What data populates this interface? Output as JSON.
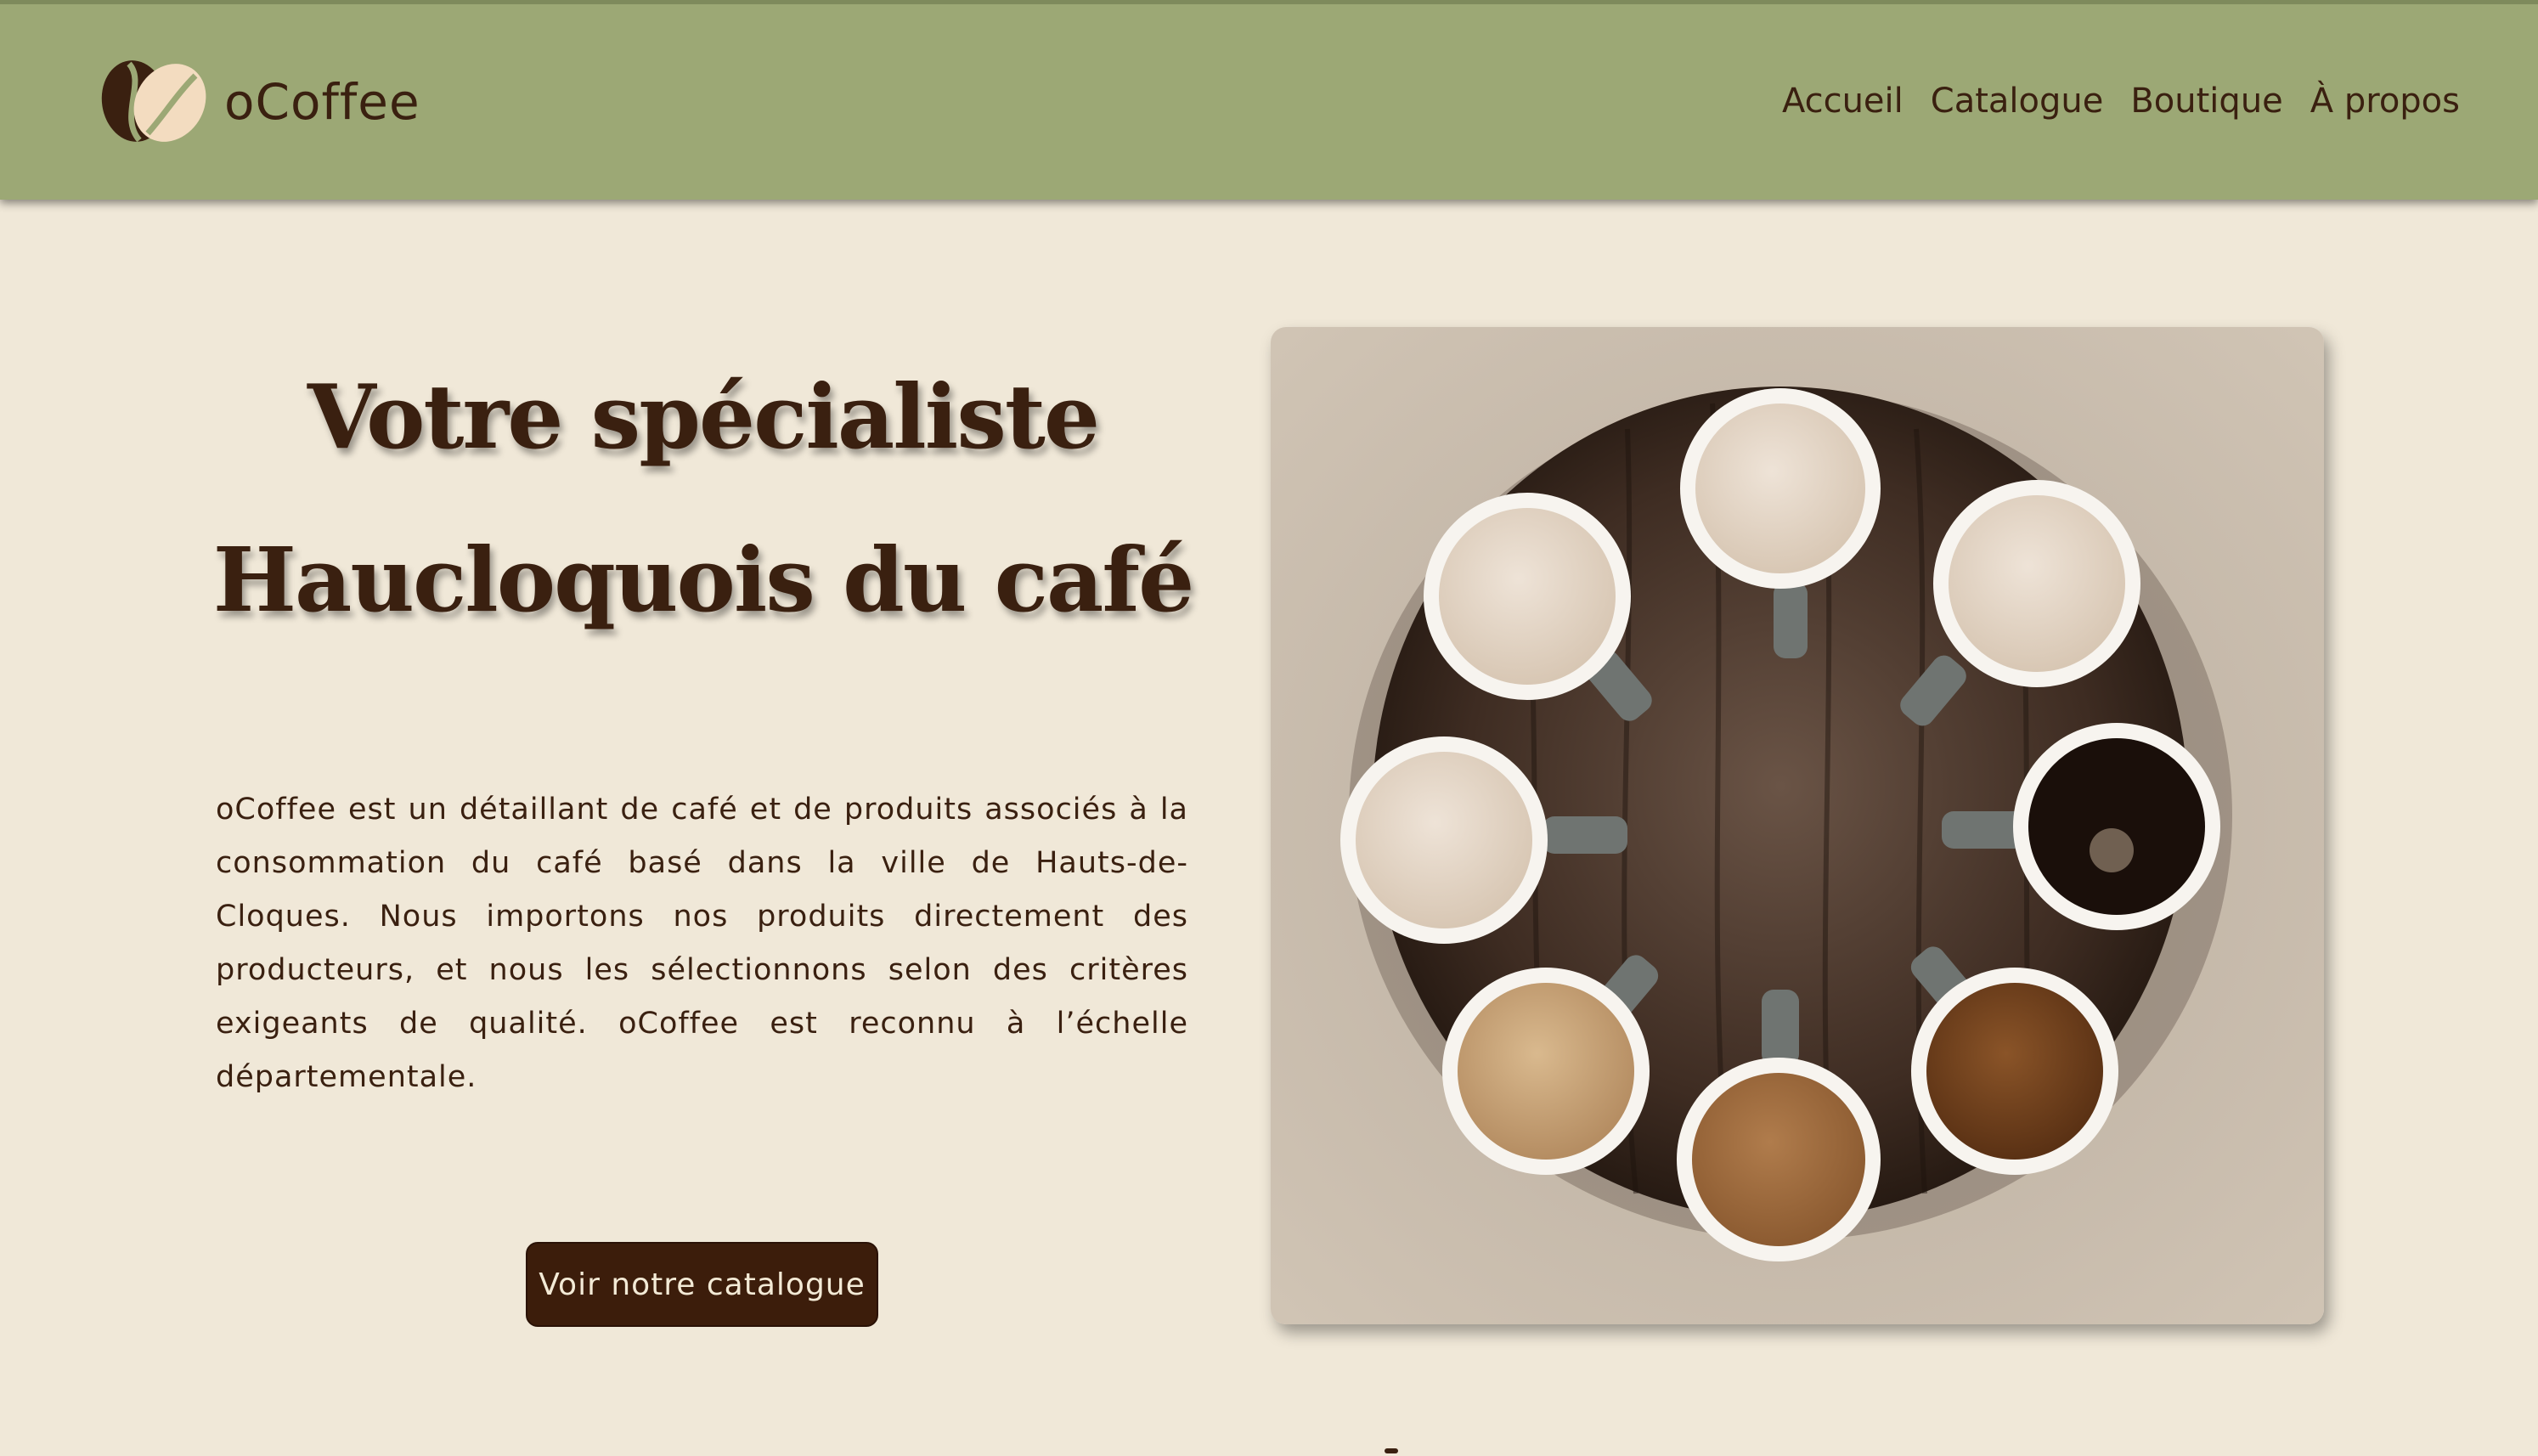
{
  "header": {
    "brand": "oCoffee",
    "logo_icon": "coffee-beans-icon",
    "nav": [
      {
        "label": "Accueil"
      },
      {
        "label": "Catalogue"
      },
      {
        "label": "Boutique"
      },
      {
        "label": "À propos"
      }
    ]
  },
  "hero": {
    "title_line1": "Votre spécialiste",
    "title_line2": "Haucloquois du café",
    "description": "oCoffee est un détaillant de café et de produits associés à la consommation du café basé dans la ville de Hauts-de-Cloques. Nous importons nos produits directement des producteurs, et nous les sélectionnons selon des critères exigeants de qualité. oCoffee est reconnu à l’échelle départementale.",
    "cta_label": "Voir notre catalogue",
    "image": "coffee-cups-on-table-photo"
  },
  "colors": {
    "header_bg": "#9ca875",
    "page_bg": "#f0e8d8",
    "text": "#3a2010",
    "button_bg": "#3c1d0b",
    "button_text": "#f3ead6"
  }
}
